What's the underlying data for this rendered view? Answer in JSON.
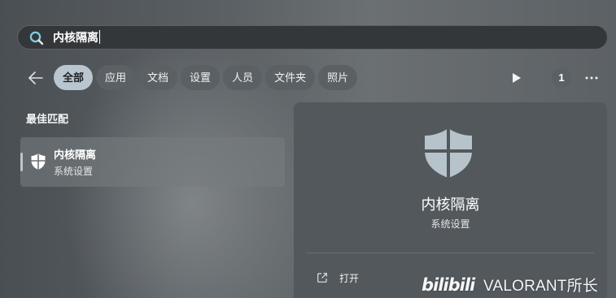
{
  "search": {
    "query": "内核隔离"
  },
  "filters": {
    "items": [
      {
        "label": "全部",
        "active": true
      },
      {
        "label": "应用",
        "active": false
      },
      {
        "label": "文档",
        "active": false
      },
      {
        "label": "设置",
        "active": false
      },
      {
        "label": "人员",
        "active": false
      },
      {
        "label": "文件夹",
        "active": false
      },
      {
        "label": "照片",
        "active": false
      }
    ],
    "count_badge": "1",
    "more_icon": "more-horizontal-icon"
  },
  "best_match": {
    "section_title": "最佳匹配",
    "result": {
      "title": "内核隔离",
      "subtitle": "系统设置",
      "icon": "windows-security-shield-icon"
    }
  },
  "detail": {
    "title": "内核隔离",
    "subtitle": "系统设置",
    "actions": [
      {
        "label": "打开",
        "icon": "open-external-icon"
      }
    ]
  },
  "watermark": {
    "logo_text": "bilibili",
    "text": "VALORANT所长"
  },
  "colors": {
    "accent": "#b9c6cf",
    "panel": "#53585c",
    "search_bg": "#343739"
  }
}
